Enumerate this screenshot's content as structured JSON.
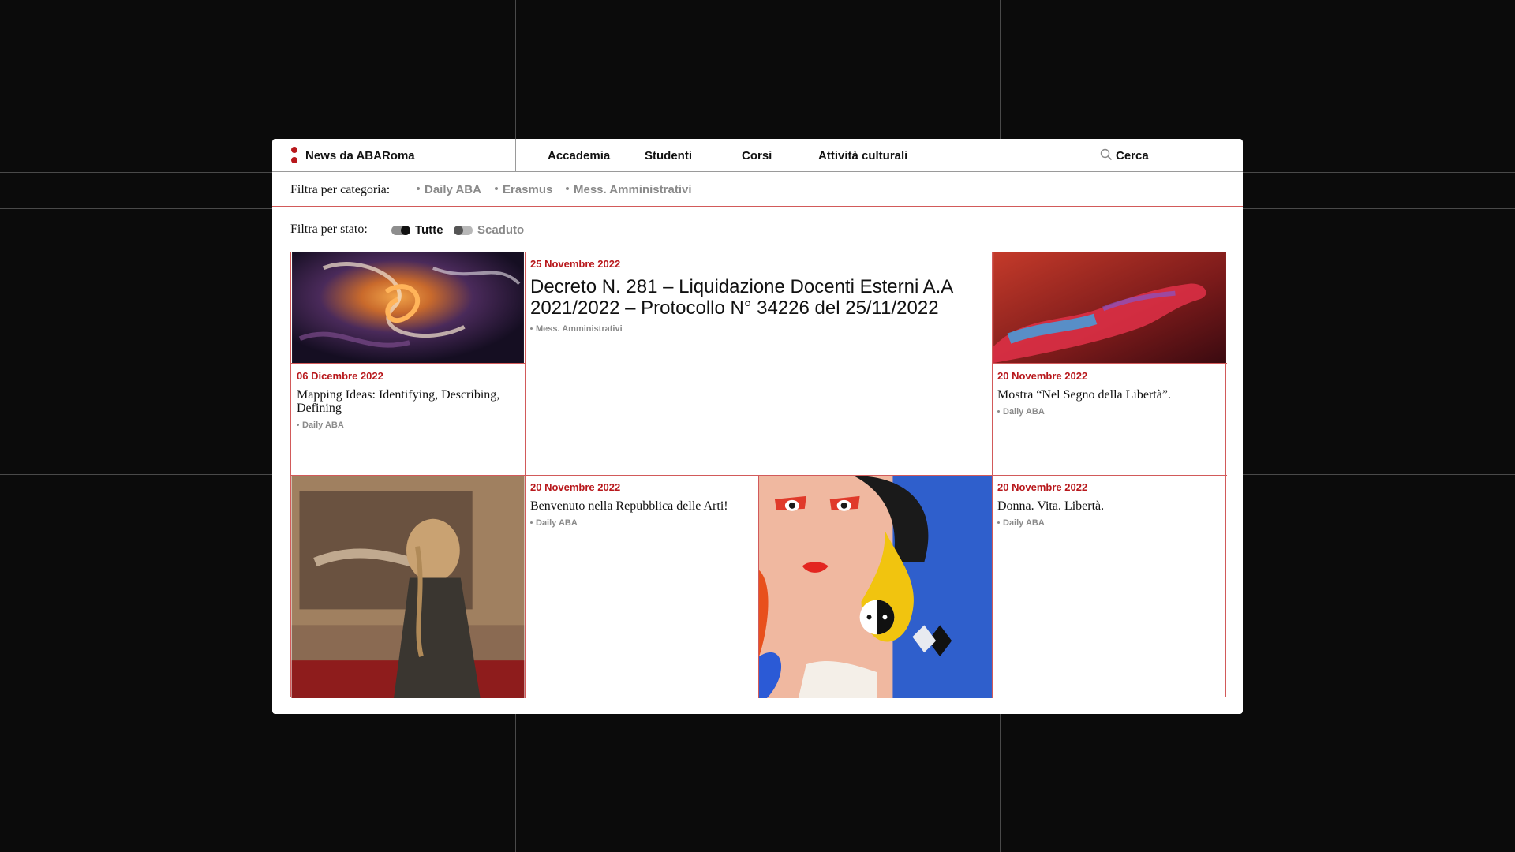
{
  "header": {
    "brand": "News da ABARoma",
    "nav": [
      "Accademia",
      "Studenti",
      "Corsi",
      "Attività culturali"
    ],
    "search_label": "Cerca"
  },
  "category_filter": {
    "label": "Filtra per categoria:",
    "options": [
      "Daily ABA",
      "Erasmus",
      "Mess. Amministrativi"
    ]
  },
  "state_filter": {
    "label": "Filtra per stato:",
    "options": [
      {
        "label": "Tutte",
        "active": true
      },
      {
        "label": "Scaduto",
        "active": false
      }
    ]
  },
  "news": [
    {
      "date": "06 Dicembre 2022",
      "title": "Mapping Ideas: Identifying, Describing, Defining",
      "tag": "Daily ABA"
    },
    {
      "date": "25 Novembre 2022",
      "title": "Decreto N. 281 – Liquidazione Docenti Esterni A.A 2021/2022 – Protocollo N° 34226 del 25/11/2022",
      "tag": "Mess. Amministrativi"
    },
    {
      "date": "20 Novembre 2022",
      "title": "Mostra “Nel Segno della Libertà”.",
      "tag": "Daily ABA"
    },
    {
      "date": "20 Novembre 2022",
      "title": "Benvenuto nella Repubblica delle Arti!",
      "tag": "Daily ABA"
    },
    {
      "date": "20 Novembre 2022",
      "title": "Donna. Vita. Libertà.",
      "tag": "Daily ABA"
    }
  ],
  "colors": {
    "accent": "#b8181c",
    "border": "#d25a5a",
    "muted": "#8a8a8a",
    "background": "#0b0b0b"
  }
}
